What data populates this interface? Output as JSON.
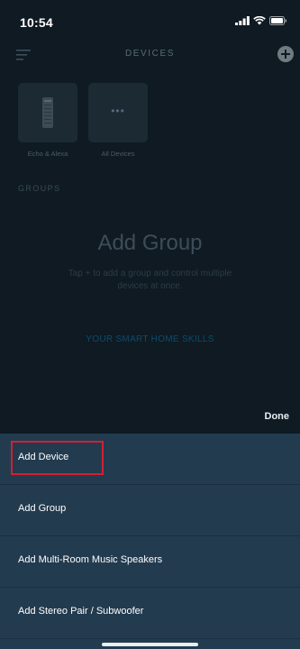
{
  "status_bar": {
    "time": "10:54"
  },
  "header": {
    "title": "DEVICES"
  },
  "tiles": [
    {
      "label": "Echo & Alexa",
      "icon": "echo-device-icon"
    },
    {
      "label": "All Devices",
      "icon": "more-dots-icon"
    }
  ],
  "groups_label": "GROUPS",
  "empty_state": {
    "title": "Add Group",
    "description": "Tap + to add a group and control multiple devices at once.",
    "link": "YOUR SMART HOME SKILLS"
  },
  "sheet": {
    "done_label": "Done",
    "items": [
      {
        "label": "Add Device",
        "highlighted": true
      },
      {
        "label": "Add Group"
      },
      {
        "label": "Add Multi-Room Music Speakers"
      },
      {
        "label": "Add Stereo Pair / Subwoofer"
      }
    ]
  },
  "colors": {
    "background": "#0f1a22",
    "sheet": "#223b4f",
    "highlight": "#d32035"
  }
}
